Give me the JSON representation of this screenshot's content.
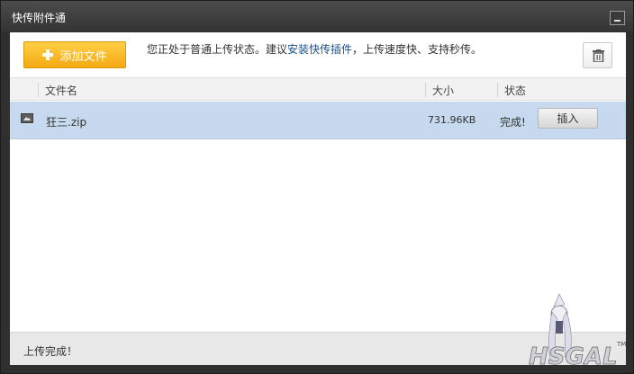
{
  "window": {
    "title": "快传附件通"
  },
  "toolbar": {
    "add_file_label": "添加文件",
    "notice_prefix": "您正处于普通上传状态。建议",
    "notice_link": "安装快传插件",
    "notice_suffix": "，上传速度快、支持秒传。"
  },
  "list": {
    "columns": [
      {
        "label": "文件名"
      },
      {
        "label": "大小"
      },
      {
        "label": "状态"
      }
    ],
    "rows": [
      {
        "icon": "image-file-icon",
        "name": "狂三.zip",
        "size": "731.96KB",
        "status": "完成!",
        "action_label": "插入"
      }
    ]
  },
  "status_bar": {
    "text": "上传完成！"
  },
  "colors": {
    "accent_button": "#f5a912",
    "selected_row": "#c6d9ee",
    "link": "#1a4f8b",
    "titlebar": "#3c3c3c"
  }
}
